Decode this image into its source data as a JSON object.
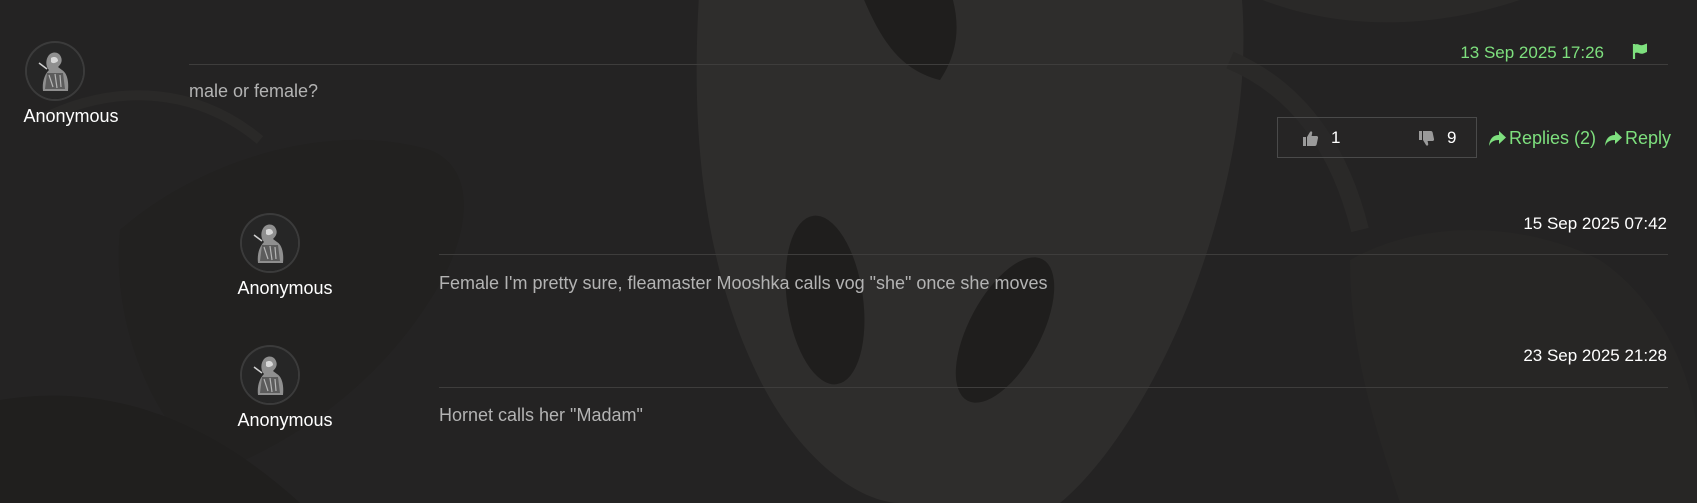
{
  "colors": {
    "accent_green": "#7ee07e",
    "text_white": "#ffffff",
    "text_muted": "#b3b3b3",
    "background": "#242323"
  },
  "main_comment": {
    "author": "Anonymous",
    "avatar_icon": "hooded-knight-avatar",
    "timestamp": "13 Sep 2025 17:26",
    "flag_icon": "flag-icon",
    "text": "male or female?",
    "upvotes": "1",
    "downvotes": "9",
    "replies_label": "Replies (2)",
    "reply_label": "Reply"
  },
  "replies": [
    {
      "author": "Anonymous",
      "avatar_icon": "hooded-knight-avatar",
      "timestamp": "15 Sep 2025 07:42",
      "text": "Female I'm pretty sure, fleamaster Mooshka calls vog \"she\" once she moves"
    },
    {
      "author": "Anonymous",
      "avatar_icon": "hooded-knight-avatar",
      "timestamp": "23 Sep 2025 21:28",
      "text": "Hornet calls her \"Madam\""
    }
  ]
}
